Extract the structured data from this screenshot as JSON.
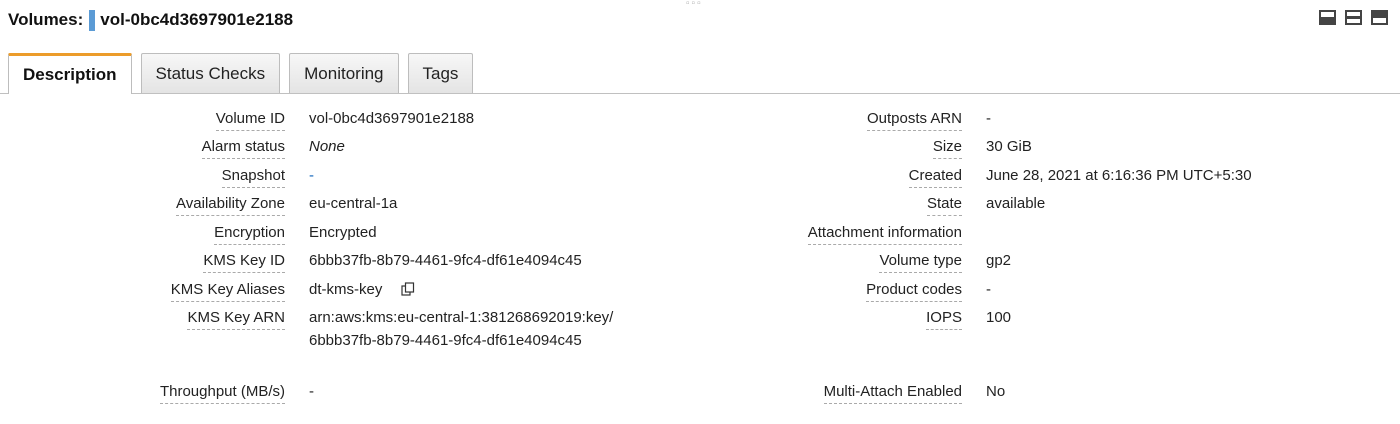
{
  "header": {
    "resource_type": "Volumes:",
    "volume_id": "vol-0bc4d3697901e2188"
  },
  "toolbar": {
    "icons": [
      "pane-bottom-icon",
      "pane-split-icon",
      "pane-top-icon"
    ]
  },
  "tabs": [
    {
      "label": "Description",
      "active": true
    },
    {
      "label": "Status Checks",
      "active": false
    },
    {
      "label": "Monitoring",
      "active": false
    },
    {
      "label": "Tags",
      "active": false
    }
  ],
  "details_left": [
    {
      "label": "Volume ID",
      "value": "vol-0bc4d3697901e2188"
    },
    {
      "label": "Alarm status",
      "value": "None"
    },
    {
      "label": "Snapshot",
      "value": "-"
    },
    {
      "label": "Availability Zone",
      "value": "eu-central-1a"
    },
    {
      "label": "Encryption",
      "value": "Encrypted"
    },
    {
      "label": "KMS Key ID",
      "value": "6bbb37fb-8b79-4461-9fc4-df61e4094c45"
    },
    {
      "label": "KMS Key Aliases",
      "value": "dt-kms-key"
    },
    {
      "label": "KMS Key ARN",
      "value": "arn:aws:kms:eu-central-1:381268692019:key/6bbb37fb-8b79-4461-9fc4-df61e4094c45"
    },
    {
      "label": "Throughput (MB/s)",
      "value": "-"
    }
  ],
  "details_right": [
    {
      "label": "Outposts ARN",
      "value": "-"
    },
    {
      "label": "Size",
      "value": "30 GiB"
    },
    {
      "label": "Created",
      "value": "June 28, 2021 at 6:16:36 PM UTC+5:30"
    },
    {
      "label": "State",
      "value": "available"
    },
    {
      "label": "Attachment information",
      "value": ""
    },
    {
      "label": "Volume type",
      "value": "gp2"
    },
    {
      "label": "Product codes",
      "value": "-"
    },
    {
      "label": "IOPS",
      "value": "100"
    },
    {
      "label": "Multi-Attach Enabled",
      "value": "No"
    }
  ],
  "colors": {
    "active_tab_accent": "#ec9c2a",
    "volume_marker": "#5b9bd5",
    "link": "#1166bb"
  }
}
